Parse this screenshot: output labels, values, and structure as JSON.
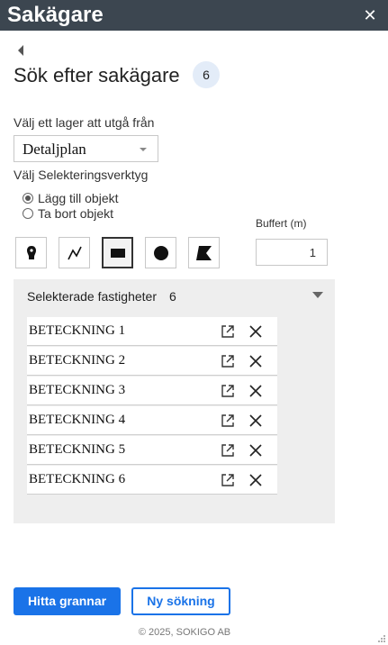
{
  "header": {
    "title": "Sakägare",
    "close_icon": "close-icon"
  },
  "page": {
    "title": "Sök efter sakägare",
    "count": "6"
  },
  "layer": {
    "label": "Välj ett lager att utgå från",
    "selected": "Detaljplan"
  },
  "tools": {
    "label": "Välj Selekteringsverktyg",
    "mode_options": [
      {
        "label": "Lägg till objekt",
        "selected": true
      },
      {
        "label": "Ta bort objekt",
        "selected": false
      }
    ],
    "buttons": [
      {
        "icon": "point-marker-icon",
        "active": false
      },
      {
        "icon": "polyline-icon",
        "active": false
      },
      {
        "icon": "rectangle-icon",
        "active": true
      },
      {
        "icon": "circle-icon",
        "active": false
      },
      {
        "icon": "polygon-icon",
        "active": false
      }
    ]
  },
  "buffer": {
    "label": "Buffert (m)",
    "value": "1"
  },
  "selected_panel": {
    "title": "Selekterade fastigheter",
    "count": "6",
    "items": [
      "BETECKNING 1",
      "BETECKNING 2",
      "BETECKNING 3",
      "BETECKNING 4",
      "BETECKNING 5",
      "BETECKNING 6"
    ]
  },
  "actions": {
    "find_neighbors": "Hitta grannar",
    "new_search": "Ny sökning"
  },
  "footer": {
    "text": "© 2025, SOKIGO AB"
  },
  "colors": {
    "header_bg": "#3c4650",
    "accent": "#1a73e8",
    "panel_bg": "#eeeeee",
    "badge_bg": "#e3ecf8"
  }
}
